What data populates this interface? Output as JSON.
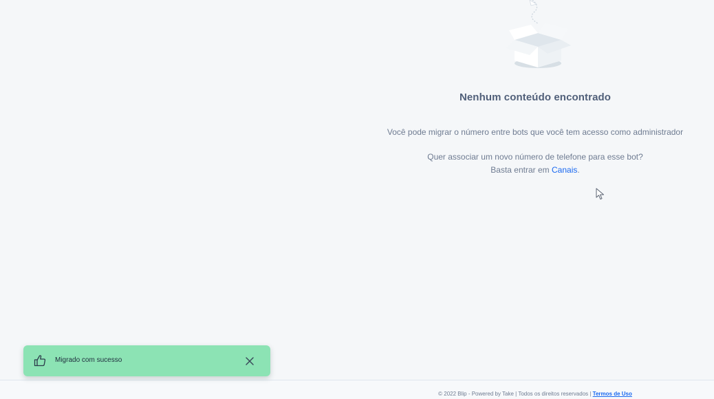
{
  "empty_state": {
    "title": "Nenhum conteúdo encontrado",
    "description": "Você pode migrar o número entre bots que você tem acesso como administrador",
    "question": "Quer associar um novo número de telefone para esse bot?",
    "cta_prefix": "Basta entrar em ",
    "cta_link": "Canais",
    "cta_suffix": ".",
    "illustration_icon": "empty-box-icon"
  },
  "toast": {
    "message": "Migrado com sucesso",
    "icon": "thumbs-up-icon",
    "close_icon": "close-icon",
    "background": "#8ce3b4"
  },
  "footer": {
    "text": "© 2022 Blip - Powered by Take | Todos os direitos reservados | ",
    "link": "Termos de Uso"
  },
  "colors": {
    "link": "#1968f0",
    "title": "#505f79",
    "body_text": "#6e7b91",
    "page_background": "#f5f7f9"
  }
}
